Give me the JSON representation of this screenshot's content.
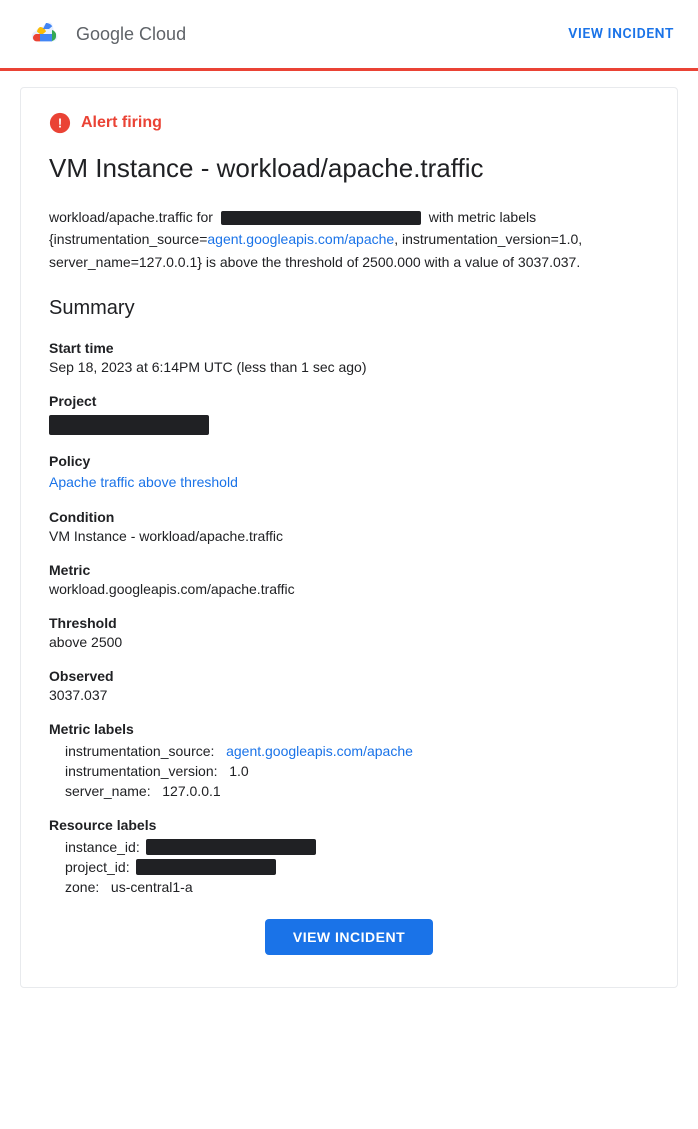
{
  "header": {
    "logo_text": "Google Cloud",
    "view_incident_label": "VIEW INCIDENT"
  },
  "alert": {
    "firing_label": "Alert firing",
    "title": "VM Instance - workload/apache.traffic",
    "description_prefix": "workload/apache.traffic for",
    "description_suffix": " with metric labels {instrumentation_source=",
    "description_link": "agent.googleapis.com/apache",
    "description_end": ", instrumentation_version=1.0, server_name=127.0.0.1} is above the threshold of 2500.000 with a value of 3037.037."
  },
  "summary": {
    "title": "Summary",
    "fields": {
      "start_time": {
        "label": "Start time",
        "value": "Sep 18, 2023 at 6:14PM UTC (less than 1 sec ago)"
      },
      "project": {
        "label": "Project"
      },
      "policy": {
        "label": "Policy",
        "link_text": "Apache traffic above threshold",
        "link_href": "#"
      },
      "condition": {
        "label": "Condition",
        "value": "VM Instance - workload/apache.traffic"
      },
      "metric": {
        "label": "Metric",
        "value": "workload.googleapis.com/apache.traffic"
      },
      "threshold": {
        "label": "Threshold",
        "value": "above 2500"
      },
      "observed": {
        "label": "Observed",
        "value": "3037.037"
      },
      "metric_labels": {
        "label": "Metric labels",
        "instrumentation_source_label": "instrumentation_source:",
        "instrumentation_source_link": "agent.googleapis.com/apache",
        "instrumentation_version_label": "instrumentation_version:",
        "instrumentation_version_value": "1.0",
        "server_name_label": "server_name:",
        "server_name_value": "127.0.0.1"
      },
      "resource_labels": {
        "label": "Resource labels",
        "instance_id_label": "instance_id:",
        "project_id_label": "project_id:",
        "zone_label": "zone:",
        "zone_value": "us-central1-a"
      }
    }
  },
  "footer": {
    "view_incident_label": "VIEW INCIDENT"
  }
}
